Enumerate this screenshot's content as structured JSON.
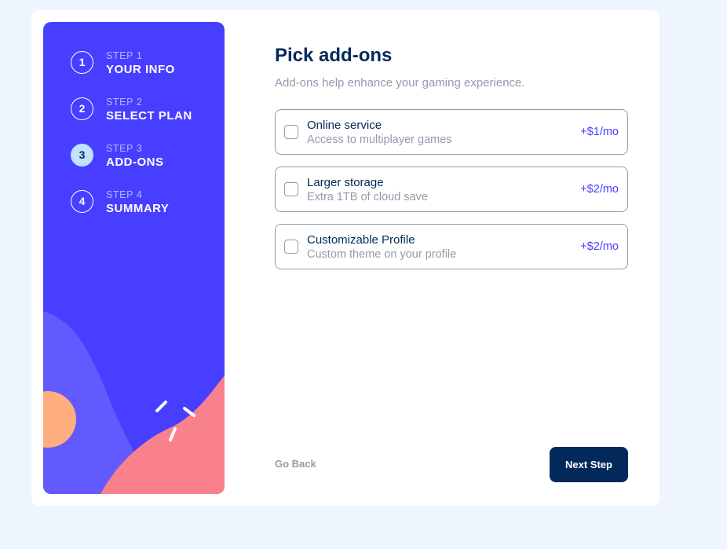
{
  "colors": {
    "page_bg": "#eff5ff",
    "sidebar_bg": "#483eff",
    "primary_dark": "#02295a",
    "accent": "#483eff",
    "muted": "#9699ab",
    "active_step_bg": "#bfe2fd"
  },
  "sidebar": {
    "steps": [
      {
        "number": "1",
        "label": "STEP 1",
        "title": "YOUR INFO",
        "active": false
      },
      {
        "number": "2",
        "label": "STEP 2",
        "title": "SELECT PLAN",
        "active": false
      },
      {
        "number": "3",
        "label": "STEP 3",
        "title": "ADD-ONS",
        "active": true
      },
      {
        "number": "4",
        "label": "STEP 4",
        "title": "SUMMARY",
        "active": false
      }
    ]
  },
  "main": {
    "title": "Pick add-ons",
    "subtitle": "Add-ons help enhance your gaming experience.",
    "addons": [
      {
        "name": "Online service",
        "description": "Access to multiplayer games",
        "price": "+$1/mo",
        "checked": false
      },
      {
        "name": "Larger storage",
        "description": "Extra 1TB of cloud save",
        "price": "+$2/mo",
        "checked": false
      },
      {
        "name": "Customizable Profile",
        "description": "Custom theme on your profile",
        "price": "+$2/mo",
        "checked": false
      }
    ]
  },
  "footer": {
    "back_label": "Go Back",
    "next_label": "Next Step"
  }
}
